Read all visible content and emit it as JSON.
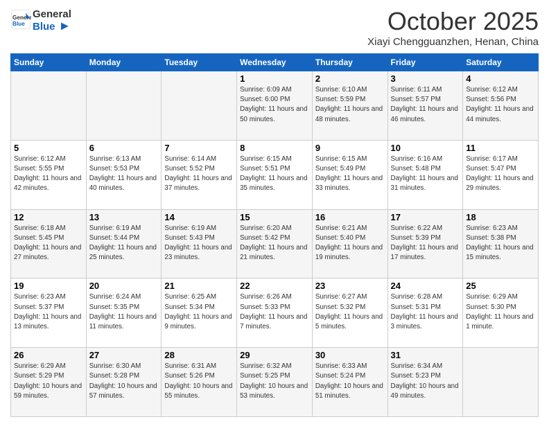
{
  "header": {
    "logo_general": "General",
    "logo_blue": "Blue",
    "month_title": "October 2025",
    "location": "Xiayi Chengguanzhen, Henan, China"
  },
  "days_of_week": [
    "Sunday",
    "Monday",
    "Tuesday",
    "Wednesday",
    "Thursday",
    "Friday",
    "Saturday"
  ],
  "weeks": [
    [
      {
        "day": "",
        "info": ""
      },
      {
        "day": "",
        "info": ""
      },
      {
        "day": "",
        "info": ""
      },
      {
        "day": "1",
        "info": "Sunrise: 6:09 AM\nSunset: 6:00 PM\nDaylight: 11 hours and 50 minutes."
      },
      {
        "day": "2",
        "info": "Sunrise: 6:10 AM\nSunset: 5:59 PM\nDaylight: 11 hours and 48 minutes."
      },
      {
        "day": "3",
        "info": "Sunrise: 6:11 AM\nSunset: 5:57 PM\nDaylight: 11 hours and 46 minutes."
      },
      {
        "day": "4",
        "info": "Sunrise: 6:12 AM\nSunset: 5:56 PM\nDaylight: 11 hours and 44 minutes."
      }
    ],
    [
      {
        "day": "5",
        "info": "Sunrise: 6:12 AM\nSunset: 5:55 PM\nDaylight: 11 hours and 42 minutes."
      },
      {
        "day": "6",
        "info": "Sunrise: 6:13 AM\nSunset: 5:53 PM\nDaylight: 11 hours and 40 minutes."
      },
      {
        "day": "7",
        "info": "Sunrise: 6:14 AM\nSunset: 5:52 PM\nDaylight: 11 hours and 37 minutes."
      },
      {
        "day": "8",
        "info": "Sunrise: 6:15 AM\nSunset: 5:51 PM\nDaylight: 11 hours and 35 minutes."
      },
      {
        "day": "9",
        "info": "Sunrise: 6:15 AM\nSunset: 5:49 PM\nDaylight: 11 hours and 33 minutes."
      },
      {
        "day": "10",
        "info": "Sunrise: 6:16 AM\nSunset: 5:48 PM\nDaylight: 11 hours and 31 minutes."
      },
      {
        "day": "11",
        "info": "Sunrise: 6:17 AM\nSunset: 5:47 PM\nDaylight: 11 hours and 29 minutes."
      }
    ],
    [
      {
        "day": "12",
        "info": "Sunrise: 6:18 AM\nSunset: 5:45 PM\nDaylight: 11 hours and 27 minutes."
      },
      {
        "day": "13",
        "info": "Sunrise: 6:19 AM\nSunset: 5:44 PM\nDaylight: 11 hours and 25 minutes."
      },
      {
        "day": "14",
        "info": "Sunrise: 6:19 AM\nSunset: 5:43 PM\nDaylight: 11 hours and 23 minutes."
      },
      {
        "day": "15",
        "info": "Sunrise: 6:20 AM\nSunset: 5:42 PM\nDaylight: 11 hours and 21 minutes."
      },
      {
        "day": "16",
        "info": "Sunrise: 6:21 AM\nSunset: 5:40 PM\nDaylight: 11 hours and 19 minutes."
      },
      {
        "day": "17",
        "info": "Sunrise: 6:22 AM\nSunset: 5:39 PM\nDaylight: 11 hours and 17 minutes."
      },
      {
        "day": "18",
        "info": "Sunrise: 6:23 AM\nSunset: 5:38 PM\nDaylight: 11 hours and 15 minutes."
      }
    ],
    [
      {
        "day": "19",
        "info": "Sunrise: 6:23 AM\nSunset: 5:37 PM\nDaylight: 11 hours and 13 minutes."
      },
      {
        "day": "20",
        "info": "Sunrise: 6:24 AM\nSunset: 5:35 PM\nDaylight: 11 hours and 11 minutes."
      },
      {
        "day": "21",
        "info": "Sunrise: 6:25 AM\nSunset: 5:34 PM\nDaylight: 11 hours and 9 minutes."
      },
      {
        "day": "22",
        "info": "Sunrise: 6:26 AM\nSunset: 5:33 PM\nDaylight: 11 hours and 7 minutes."
      },
      {
        "day": "23",
        "info": "Sunrise: 6:27 AM\nSunset: 5:32 PM\nDaylight: 11 hours and 5 minutes."
      },
      {
        "day": "24",
        "info": "Sunrise: 6:28 AM\nSunset: 5:31 PM\nDaylight: 11 hours and 3 minutes."
      },
      {
        "day": "25",
        "info": "Sunrise: 6:29 AM\nSunset: 5:30 PM\nDaylight: 11 hours and 1 minute."
      }
    ],
    [
      {
        "day": "26",
        "info": "Sunrise: 6:29 AM\nSunset: 5:29 PM\nDaylight: 10 hours and 59 minutes."
      },
      {
        "day": "27",
        "info": "Sunrise: 6:30 AM\nSunset: 5:28 PM\nDaylight: 10 hours and 57 minutes."
      },
      {
        "day": "28",
        "info": "Sunrise: 6:31 AM\nSunset: 5:26 PM\nDaylight: 10 hours and 55 minutes."
      },
      {
        "day": "29",
        "info": "Sunrise: 6:32 AM\nSunset: 5:25 PM\nDaylight: 10 hours and 53 minutes."
      },
      {
        "day": "30",
        "info": "Sunrise: 6:33 AM\nSunset: 5:24 PM\nDaylight: 10 hours and 51 minutes."
      },
      {
        "day": "31",
        "info": "Sunrise: 6:34 AM\nSunset: 5:23 PM\nDaylight: 10 hours and 49 minutes."
      },
      {
        "day": "",
        "info": ""
      }
    ]
  ]
}
